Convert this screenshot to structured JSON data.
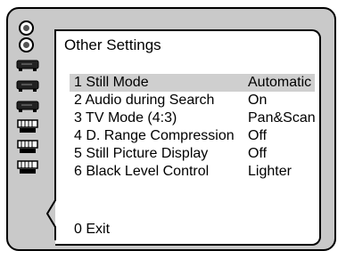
{
  "panel": {
    "title": "Other Settings",
    "items": [
      {
        "label": "1 Still Mode",
        "value": "Automatic",
        "selected": true
      },
      {
        "label": "2 Audio during Search",
        "value": "On"
      },
      {
        "label": "3 TV Mode (4:3)",
        "value": "Pan&Scan"
      },
      {
        "label": "4 D. Range Compression",
        "value": "Off"
      },
      {
        "label": "5 Still Picture Display",
        "value": "Off"
      },
      {
        "label": "6 Black Level Control",
        "value": "Lighter"
      }
    ],
    "exit_label": "0 Exit"
  },
  "sidebar": {
    "icons": [
      "disc-icon",
      "disc-icon",
      "player-icon",
      "player-icon",
      "player-icon",
      "speaker-icon",
      "speaker-icon",
      "speaker-icon"
    ],
    "active_index": 7
  },
  "colors": {
    "frame": "#c9c9c9",
    "panel": "#ffffff",
    "selection": "#cfcfcf",
    "outline": "#000000"
  }
}
